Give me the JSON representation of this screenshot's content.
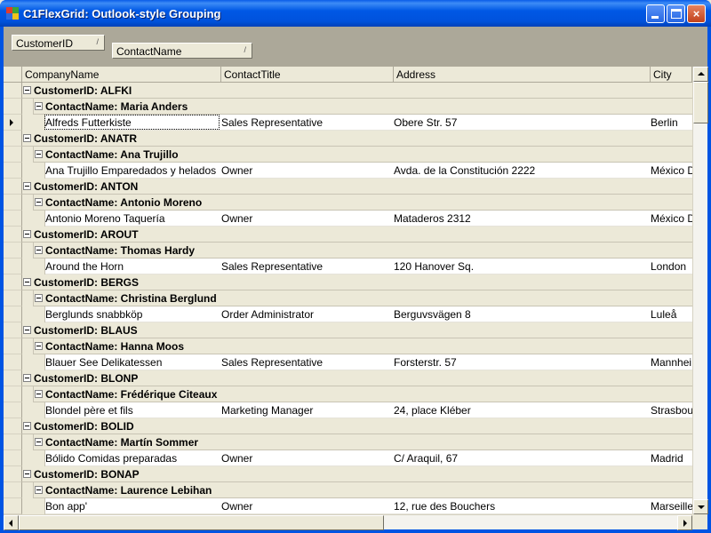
{
  "window": {
    "title": "C1FlexGrid: Outlook-style Grouping",
    "app_icon": "windows-app-icon",
    "buttons": {
      "minimize": "minimize-icon",
      "maximize": "maximize-icon",
      "close": "×"
    }
  },
  "group_by": [
    {
      "label": "CustomerID",
      "sort_glyph": "/"
    },
    {
      "label": "ContactName",
      "sort_glyph": "/"
    }
  ],
  "columns": [
    "CompanyName",
    "ContactTitle",
    "Address",
    "City"
  ],
  "groups": [
    {
      "customer": "CustomerID: ALFKI",
      "contact": "ContactName: Maria Anders",
      "row": {
        "company": "Alfreds Futterkiste",
        "title": "Sales Representative",
        "address": "Obere Str. 57",
        "city": "Berlin"
      }
    },
    {
      "customer": "CustomerID: ANATR",
      "contact": "ContactName: Ana Trujillo",
      "row": {
        "company": "Ana Trujillo Emparedados y helados",
        "title": "Owner",
        "address": "Avda. de la Constitución 2222",
        "city": "México D"
      }
    },
    {
      "customer": "CustomerID: ANTON",
      "contact": "ContactName: Antonio Moreno",
      "row": {
        "company": "Antonio Moreno Taquería",
        "title": "Owner",
        "address": "Mataderos  2312",
        "city": "México D"
      }
    },
    {
      "customer": "CustomerID: AROUT",
      "contact": "ContactName: Thomas Hardy",
      "row": {
        "company": "Around the Horn",
        "title": "Sales Representative",
        "address": "120 Hanover Sq.",
        "city": "London"
      }
    },
    {
      "customer": "CustomerID: BERGS",
      "contact": "ContactName: Christina Berglund",
      "row": {
        "company": "Berglunds snabbköp",
        "title": "Order Administrator",
        "address": "Berguvsvägen  8",
        "city": "Luleå"
      }
    },
    {
      "customer": "CustomerID: BLAUS",
      "contact": "ContactName: Hanna Moos",
      "row": {
        "company": "Blauer See Delikatessen",
        "title": "Sales Representative",
        "address": "Forsterstr. 57",
        "city": "Mannhei"
      }
    },
    {
      "customer": "CustomerID: BLONP",
      "contact": "ContactName: Frédérique Citeaux",
      "row": {
        "company": "Blondel père et fils",
        "title": "Marketing Manager",
        "address": "24, place Kléber",
        "city": "Strasbou"
      }
    },
    {
      "customer": "CustomerID: BOLID",
      "contact": "ContactName: Martín Sommer",
      "row": {
        "company": "Bólido Comidas preparadas",
        "title": "Owner",
        "address": "C/ Araquil, 67",
        "city": "Madrid"
      }
    },
    {
      "customer": "CustomerID: BONAP",
      "contact": "ContactName: Laurence Lebihan",
      "row": {
        "company": "Bon app'",
        "title": "Owner",
        "address": "12, rue des Bouchers",
        "city": "Marseille"
      }
    }
  ]
}
